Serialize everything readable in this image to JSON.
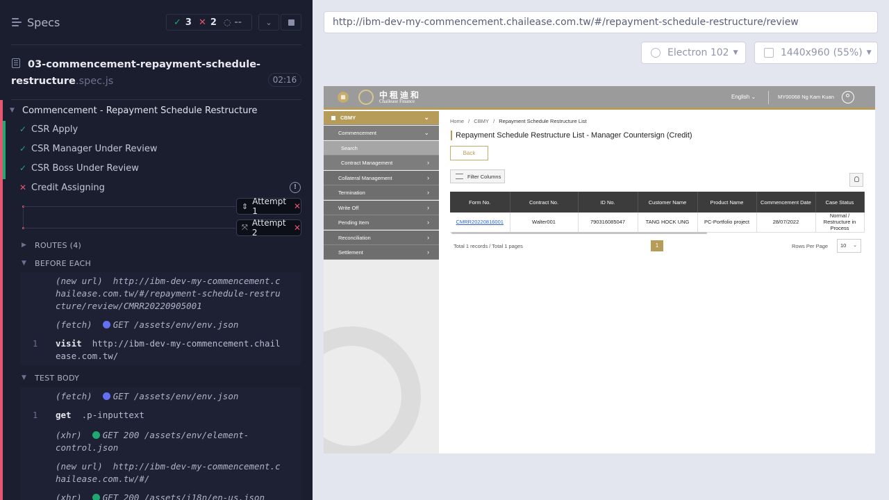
{
  "reporter": {
    "header": {
      "title": "Specs",
      "passed": "3",
      "failed": "2",
      "pending": "--"
    },
    "spec": {
      "name": "03-commencement-repayment-schedule-restructure",
      "ext": ".spec.js",
      "duration": "02:16"
    },
    "suite": {
      "title": "Commencement - Repayment Schedule Restructure",
      "tests": [
        {
          "label": "CSR Apply",
          "state": "passed"
        },
        {
          "label": "CSR Manager Under Review",
          "state": "passed"
        },
        {
          "label": "CSR Boss Under Review",
          "state": "passed"
        },
        {
          "label": "Credit Assigning",
          "state": "failed"
        }
      ]
    },
    "attempts": [
      "Attempt 1",
      "Attempt 2"
    ],
    "sections": {
      "routes": "ROUTES (4)",
      "before_each": "BEFORE EACH",
      "test_body": "TEST BODY"
    },
    "before_each_cmds": {
      "c1_event": "(new url)",
      "c1_url": "http://ibm-dev-my-commencement.chailease.com.tw/#/repayment-schedule-restructure/review/CMRR20220905001",
      "c2_event": "(fetch)",
      "c2_value": "GET /assets/env/env.json",
      "c3_no": "1",
      "c3_cmd": "visit",
      "c3_arg": "http://ibm-dev-my-commencement.chailease.com.tw/"
    },
    "test_body_cmds": {
      "c1_event": "(fetch)",
      "c1_value": "GET /assets/env/env.json",
      "c2_no": "1",
      "c2_cmd": "get",
      "c2_arg": ".p-inputtext",
      "c3_event": "(xhr)",
      "c3_value": "GET 200 /assets/env/element-control.json",
      "c4_event": "(new url)",
      "c4_url": "http://ibm-dev-my-commencement.chailease.com.tw/#/",
      "c5_event": "(xhr)",
      "c5_value": "GET 200 /assets/i18n/en-us.json"
    }
  },
  "aut_bar": {
    "url": "http://ibm-dev-my-commencement.chailease.com.tw/#/repayment-schedule-restructure/review",
    "browser": "Electron 102",
    "viewport": "1440x960",
    "zoom": "(55%)"
  },
  "app": {
    "logo_cn": "中租迪和",
    "logo_en": "Chailease Finance",
    "language": "English",
    "user": "MY00068 Ng Kam Kuan",
    "sidebar": {
      "cbmy": "CBMY",
      "commencement": "Commencement",
      "search": "Search",
      "contract_management": "Contract Management",
      "items": [
        "Collateral Management",
        "Termination",
        "Write Off",
        "Pending Item",
        "Reconciliation",
        "Settlement"
      ]
    },
    "breadcrumb": [
      "Home",
      "/",
      "CBMY",
      "/",
      "Repayment Schedule Restructure List"
    ],
    "page_title": "Repayment Schedule Restructure List - Manager Countersign (Credit)",
    "back_label": "Back",
    "filter_label": "Filter Columns",
    "table": {
      "headers": [
        "Form No.",
        "Contract No.",
        "ID No.",
        "Customer Name",
        "Product Name",
        "Commencement Date",
        "Case Status"
      ],
      "row": [
        "CMRR20220816001",
        "Walter001",
        "790316085047",
        "TANG HOCK UNG",
        "PC-Portfolio project",
        "28/07/2022",
        "Normal / Restructure in Process"
      ]
    },
    "pager": {
      "summary": "Total 1 records / Total 1 pages",
      "current_page": "1",
      "rows_label": "Rows Per Page",
      "rows_value": "10"
    },
    "colors": {
      "gold": "#b79b59",
      "header_gray": "#9b9b9b",
      "reporter_bg": "#1b1e2e",
      "pass": "#1fa971",
      "fail": "#e45770"
    }
  }
}
